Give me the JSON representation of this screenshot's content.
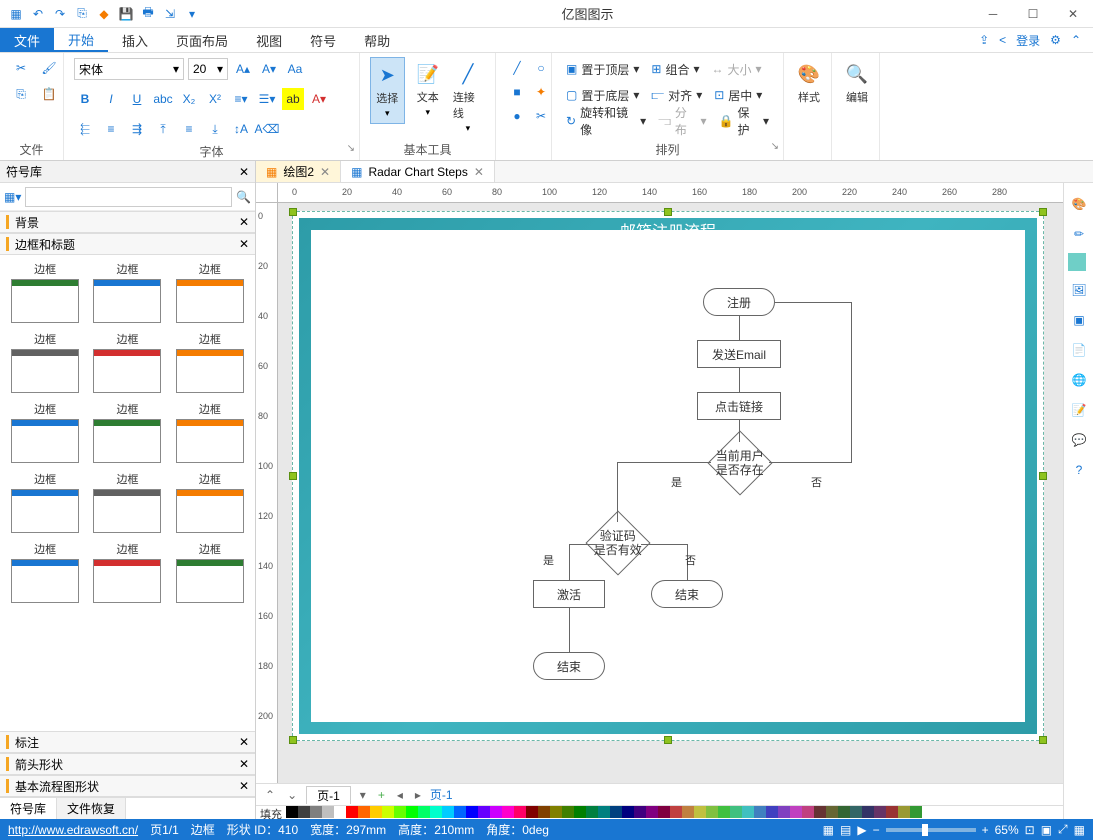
{
  "app": {
    "title": "亿图图示"
  },
  "qat": [
    "save",
    "undo",
    "redo",
    "new",
    "open",
    "disk",
    "print",
    "export"
  ],
  "menu": {
    "file": "文件",
    "tabs": [
      "开始",
      "插入",
      "页面布局",
      "视图",
      "符号",
      "帮助"
    ],
    "active": "开始",
    "login": "登录"
  },
  "ribbon": {
    "groups": {
      "file": "文件",
      "font": "字体",
      "basic_tools": "基本工具",
      "arrange": "排列",
      "style": "样式",
      "edit": "编辑"
    },
    "font": {
      "name": "宋体",
      "size": "20"
    },
    "tools": {
      "select": "选择",
      "text": "文本",
      "connector": "连接线"
    },
    "arrange": {
      "bring_front": "置于顶层",
      "send_back": "置于底层",
      "rotate": "旋转和镜像",
      "group": "组合",
      "align": "对齐",
      "distribute": "分布",
      "size": "大小",
      "center": "居中",
      "protect": "保护"
    }
  },
  "left_panel": {
    "title": "符号库",
    "categories": {
      "background": "背景",
      "border_title": "边框和标题",
      "callout": "标注",
      "arrow": "箭头形状",
      "basic_flow": "基本流程图形状"
    },
    "shapes_label": "边框",
    "tabs": {
      "symbols": "符号库",
      "recovery": "文件恢复"
    },
    "thumb_colors": [
      "#2e7d32",
      "#1976d2",
      "#f57c00",
      "#616161",
      "#d32f2f",
      "#f57c00",
      "#1976d2",
      "#2e7d32",
      "#f57c00",
      "#1976d2",
      "#616161",
      "#f57c00",
      "#1976d2",
      "#d32f2f",
      "#2e7d32"
    ]
  },
  "doc_tabs": [
    {
      "label": "绘图2",
      "active": true
    },
    {
      "label": "Radar Chart Steps",
      "active": false
    }
  ],
  "canvas": {
    "page_title": "邮箱注册流程",
    "nodes": {
      "register": "注册",
      "send_email": "发送Email",
      "click_link": "点击链接",
      "user_exists": "当前用户\n是否存在",
      "code_valid": "验证码\n是否有效",
      "activate": "激活",
      "end1": "结束",
      "end2": "结束"
    },
    "labels": {
      "yes": "是",
      "no": "否"
    }
  },
  "page_bar": {
    "page": "页-1",
    "page2": "页-1",
    "fill_label": "填充"
  },
  "status": {
    "url": "http://www.edrawsoft.cn/",
    "page_info": "页1/1",
    "shape": "边框",
    "id_label": "形状 ID：",
    "id": "410",
    "width_label": "宽度：",
    "width": "297mm",
    "height_label": "高度：",
    "height": "210mm",
    "angle_label": "角度：",
    "angle": "0deg",
    "zoom": "65%"
  },
  "ruler_h": [
    "0",
    "20",
    "40",
    "60",
    "80",
    "100",
    "120",
    "140",
    "160",
    "180",
    "200",
    "220",
    "240",
    "260",
    "280"
  ],
  "ruler_v": [
    "0",
    "20",
    "40",
    "60",
    "80",
    "100",
    "120",
    "140",
    "160",
    "180",
    "200"
  ],
  "palette": [
    "#000000",
    "#3f3f3f",
    "#7f7f7f",
    "#bfbfbf",
    "#ffffff",
    "#ff0000",
    "#ff6600",
    "#ffcc00",
    "#ccff00",
    "#66ff00",
    "#00ff00",
    "#00ff66",
    "#00ffcc",
    "#00ccff",
    "#0066ff",
    "#0000ff",
    "#6600ff",
    "#cc00ff",
    "#ff00cc",
    "#ff0066",
    "#800000",
    "#804000",
    "#808000",
    "#408000",
    "#008000",
    "#008040",
    "#008080",
    "#004080",
    "#000080",
    "#400080",
    "#800080",
    "#800040",
    "#c04040",
    "#c08040",
    "#c0c040",
    "#80c040",
    "#40c040",
    "#40c080",
    "#40c0c0",
    "#4080c0",
    "#4040c0",
    "#8040c0",
    "#c040c0",
    "#c04080",
    "#663333",
    "#666633",
    "#336633",
    "#336666",
    "#333366",
    "#663366",
    "#993333",
    "#999933",
    "#339933"
  ]
}
